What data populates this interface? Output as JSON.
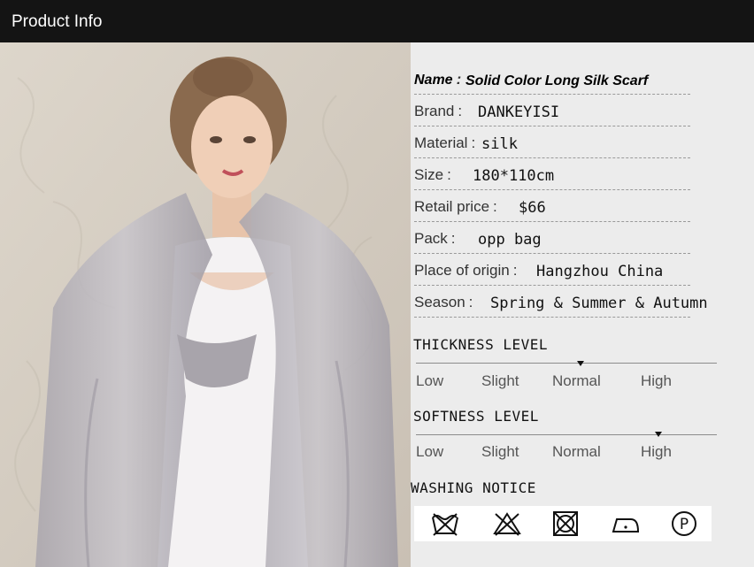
{
  "header": {
    "title": "Product Info"
  },
  "specs": [
    {
      "key": "name",
      "label": "Name",
      "sep": ":",
      "value": "Solid Color Long Silk Scarf"
    },
    {
      "key": "brand",
      "label": "Brand",
      "sep": ":",
      "value": "DANKEYISI"
    },
    {
      "key": "material",
      "label": "Material",
      "sep": ":",
      "value": "silk"
    },
    {
      "key": "size",
      "label": "Size",
      "sep": ":",
      "value": "180*110cm"
    },
    {
      "key": "retail-price",
      "label": "Retail price",
      "sep": ":",
      "value": "$66"
    },
    {
      "key": "pack",
      "label": "Pack",
      "sep": ":",
      "value": "opp bag"
    },
    {
      "key": "place-of-origin",
      "label": "Place of origin",
      "sep": ":",
      "value": "Hangzhou China"
    },
    {
      "key": "season",
      "label": "Season",
      "sep": ":",
      "value": "Spring & Summer & Autumn"
    }
  ],
  "thickness": {
    "title": "THICKNESS LEVEL",
    "levels": [
      "Low",
      "Slight",
      "Normal",
      "High"
    ],
    "selected_index": 2
  },
  "softness": {
    "title": "SOFTNESS LEVEL",
    "levels": [
      "Low",
      "Slight",
      "Normal",
      "High"
    ],
    "selected_index": 3
  },
  "washing": {
    "title": "WASHING NOTICE",
    "icons": [
      "do-not-wash-icon",
      "do-not-bleach-icon",
      "do-not-tumble-dry-icon",
      "iron-low-heat-icon",
      "dry-clean-p-icon"
    ],
    "dry_clean_letter": "P"
  },
  "colors": {
    "header_bg": "#141414",
    "panel_bg": "#ececec",
    "scarf": "#b9b6bc"
  }
}
